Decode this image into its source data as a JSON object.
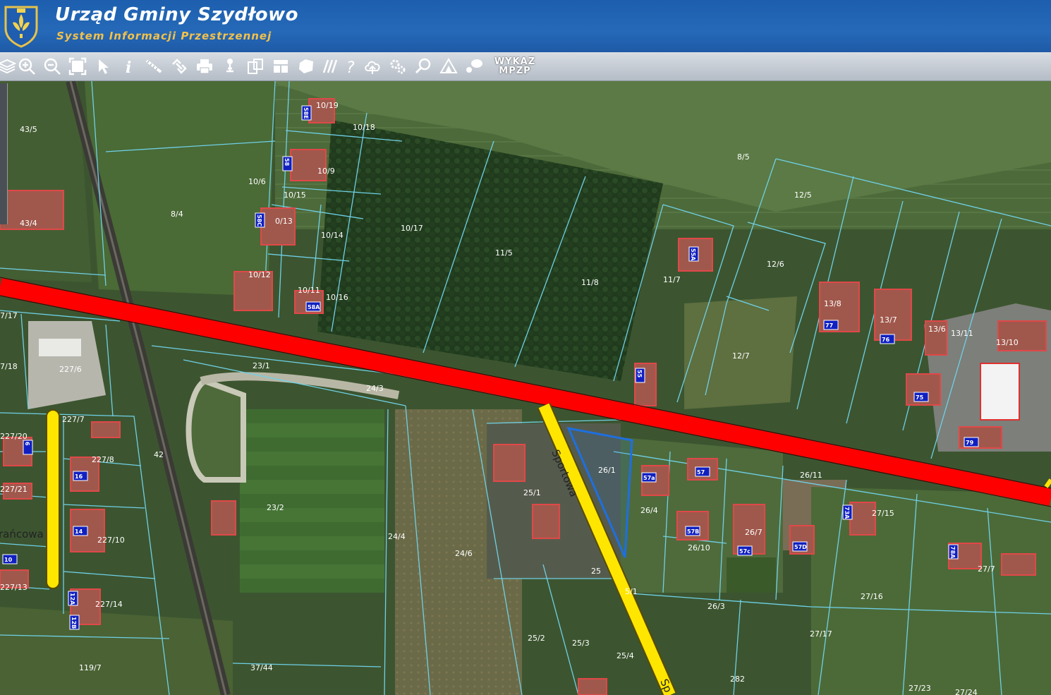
{
  "header": {
    "title": "Urząd Gminy Szydłowo",
    "subtitle": "System Informacji Przestrzennej"
  },
  "toolbar": {
    "icons": [
      "layers-icon",
      "zoom-in-icon",
      "zoom-out-icon",
      "zoom-extent-icon",
      "select-arrow-icon",
      "info-icon",
      "measure-ruler-icon",
      "link-icon",
      "print-icon",
      "pin-icon",
      "copy-icon",
      "layout-icon",
      "area-icon",
      "hatch-icon",
      "help-icon",
      "cloud-upload-icon",
      "settings-icon",
      "search-icon",
      "terrain-icon",
      "chat-icon"
    ],
    "wykaz_line1": "WYKAZ",
    "wykaz_line2": "MPZP"
  },
  "map": {
    "parcels": [
      "43/5",
      "43/4",
      "8/4",
      "10/19",
      "10/18",
      "10/9",
      "10/6",
      "10/15",
      "0/13",
      "10/14",
      "10/17",
      "11/5",
      "11/8",
      "10/12",
      "10/11",
      "10/16",
      "8/5",
      "12/5",
      "12/6",
      "11/7",
      "13/8",
      "13/7",
      "13/6",
      "13/11",
      "13/10",
      "12/7",
      "7/17",
      "7/18",
      "227/6",
      "23/1",
      "24/3",
      "227/7",
      "227/20",
      "227/8",
      "227/21",
      "227/10",
      "227/13",
      "227/14",
      "42",
      "23/2",
      "24/4",
      "24/6",
      "26/1",
      "25/1",
      "26/4",
      "26/11",
      "27/15",
      "26/7",
      "26/10",
      "27/7",
      "27/16",
      "26/3",
      "27/17",
      "25/2",
      "25/3",
      "25/4",
      "37/44",
      "119/7",
      "282",
      "27/23",
      "27/24",
      "25",
      "5/1"
    ],
    "house_numbers": [
      "58E",
      "58",
      "58C",
      "58A",
      "55A",
      "55",
      "77",
      "76",
      "75",
      "79",
      "57",
      "57a",
      "57B",
      "57c",
      "57D",
      "73A",
      "78A",
      "16",
      "14",
      "10",
      "12A",
      "12B",
      "6"
    ],
    "streets": [
      "Sportowa",
      "rańcowa"
    ],
    "colors": {
      "main_road": "#ff0000",
      "local_road": "#ffe600",
      "parcel_line": "#6fd0e6",
      "selected_parcel": "#1e6fe0"
    }
  }
}
